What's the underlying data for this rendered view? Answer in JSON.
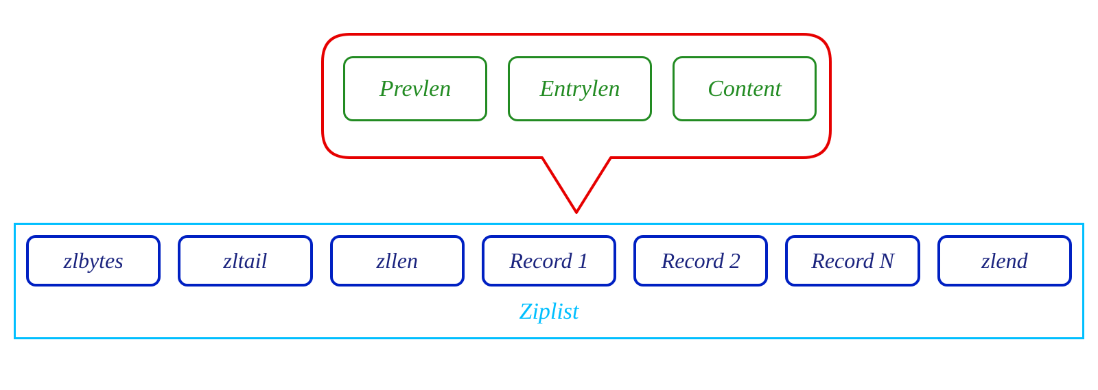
{
  "callout": {
    "items": [
      {
        "label": "Prevlen"
      },
      {
        "label": "Entrylen"
      },
      {
        "label": "Content"
      }
    ]
  },
  "ziplist": {
    "label": "Ziplist",
    "items": [
      {
        "label": "zlbytes"
      },
      {
        "label": "zltail"
      },
      {
        "label": "zllen"
      },
      {
        "label": "Record 1"
      },
      {
        "label": "Record 2"
      },
      {
        "label": "Record N"
      },
      {
        "label": "zlend"
      }
    ]
  },
  "colors": {
    "calloutBorder": "#E60000",
    "greenBox": "#228B22",
    "blueBox": "#0020C2",
    "ziplistBorder": "#00BFFF",
    "ziplistLabel": "#00BFFF"
  }
}
